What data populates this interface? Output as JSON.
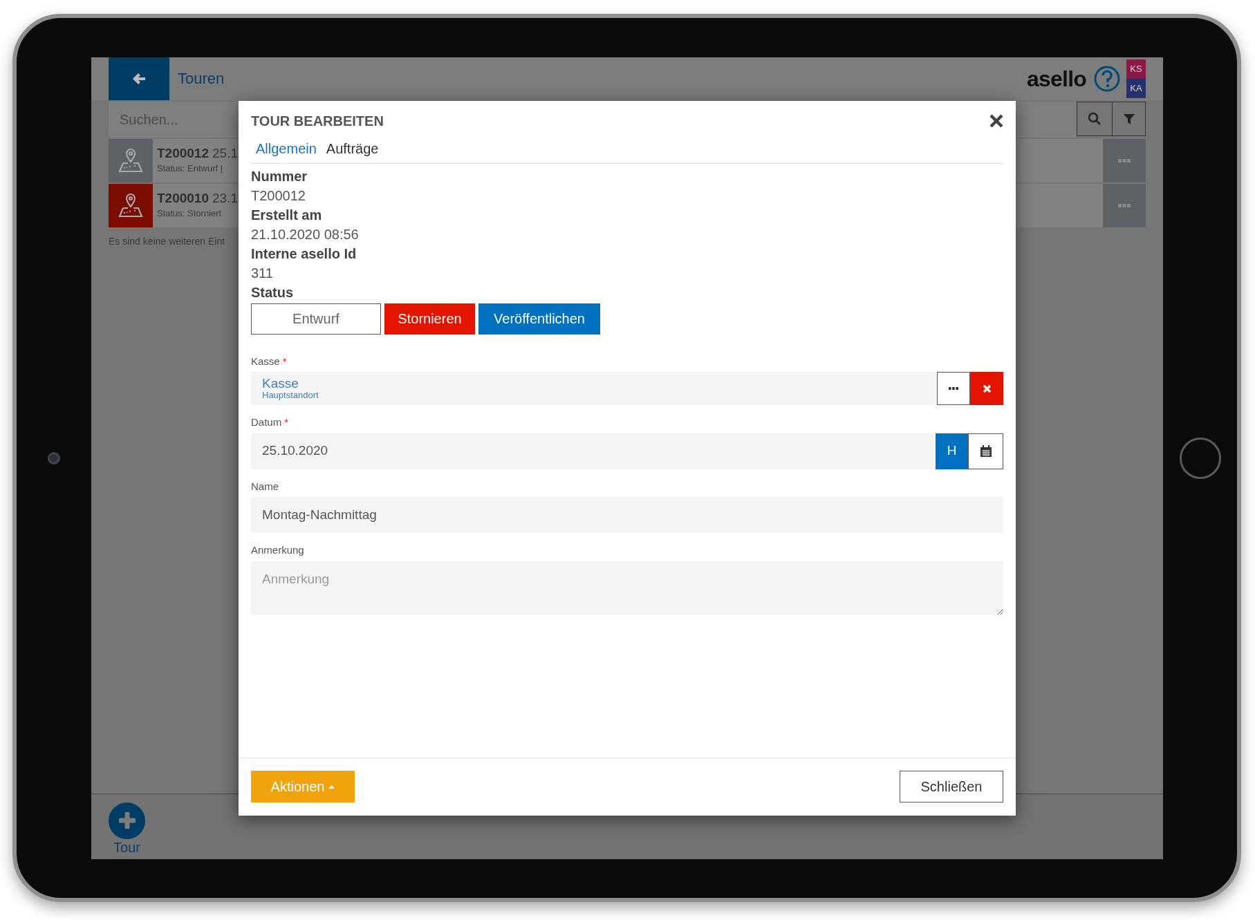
{
  "header": {
    "title": "Touren",
    "logo": "asello",
    "user_badges": [
      {
        "label": "KS",
        "color": "#8a1a45"
      },
      {
        "label": "KA",
        "color": "#26306e"
      }
    ]
  },
  "search": {
    "placeholder": "Suchen..."
  },
  "tours": [
    {
      "number": "T200012",
      "date": "25.1",
      "status": "Status: Entwurf |",
      "kind": "draft"
    },
    {
      "number": "T200010",
      "date": "23.1",
      "status": "Status: Storniert",
      "kind": "cancelled"
    }
  ],
  "list_footer": "Es sind keine weiteren Eint",
  "bottom_bar": {
    "add_label": "Tour"
  },
  "dialog": {
    "title": "TOUR BEARBEITEN",
    "tabs": [
      {
        "label": "Allgemein",
        "selected": true
      },
      {
        "label": "Aufträge",
        "selected": false
      }
    ],
    "info": [
      {
        "label": "Nummer",
        "value": "T200012"
      },
      {
        "label": "Erstellt am",
        "value": "21.10.2020 08:56"
      },
      {
        "label": "Interne asello Id",
        "value": "311"
      }
    ],
    "status": {
      "label": "Status",
      "buttons": [
        {
          "label": "Entwurf",
          "kind": "current"
        },
        {
          "label": "Stornieren",
          "kind": "danger"
        },
        {
          "label": "Veröffentlichen",
          "kind": "primary"
        }
      ]
    },
    "fields": [
      {
        "kind": "lookup",
        "label": "Kasse",
        "required_mark": "*",
        "value": "Kasse",
        "subvalue": "Hauptstandort"
      },
      {
        "kind": "date",
        "label": "Datum",
        "required_mark": "*",
        "value": "25.10.2020",
        "today_button": "H"
      },
      {
        "kind": "text",
        "label": "Name",
        "value": "Montag-Nachmittag"
      },
      {
        "kind": "textarea",
        "label": "Anmerkung",
        "placeholder": "Anmerkung"
      }
    ],
    "footer": {
      "actions": "Aktionen",
      "close": "Schließen"
    }
  }
}
